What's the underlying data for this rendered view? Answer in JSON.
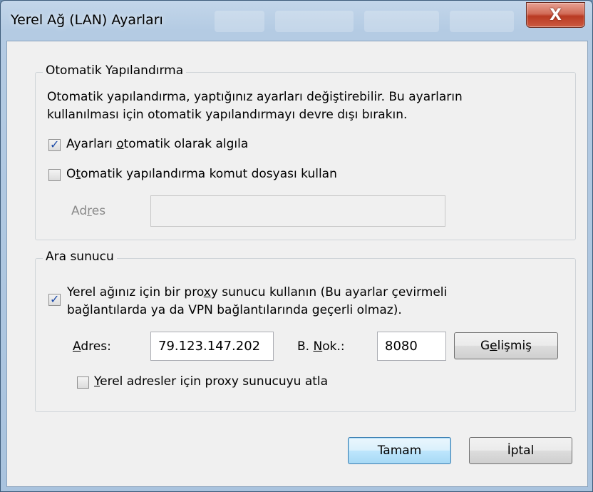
{
  "window": {
    "title": "Yerel Ağ (LAN) Ayarları",
    "close_label": "X"
  },
  "auto_config": {
    "group_title": "Otomatik Yapılandırma",
    "description_line1": "Otomatik yapılandırma, yaptığınız ayarları değiştirebilir. Bu ayarların",
    "description_line2": "kullanılması için otomatik yapılandırmayı devre dışı bırakın.",
    "detect": {
      "label_pre": "Ayarları ",
      "label_u": "o",
      "label_post": "tomatik olarak algıla",
      "checked": true
    },
    "script": {
      "label_pre": "O",
      "label_u": "t",
      "label_post": "omatik yapılandırma komut dosyası kullan",
      "checked": false
    },
    "address": {
      "label_pre": "Ad",
      "label_u": "r",
      "label_post": "es",
      "value": ""
    }
  },
  "proxy": {
    "group_title": "Ara sunucu",
    "use_proxy": {
      "line1_pre": "Yerel ağınız için bir pro",
      "line1_u": "x",
      "line1_post": "y sunucu kullanın (Bu ayarlar çevirmeli",
      "line2": "bağlantılarda ya da VPN bağlantılarında geçerli olmaz).",
      "checked": true
    },
    "address": {
      "label_u": "A",
      "label_post": "dres:",
      "value": "79.123.147.202"
    },
    "port": {
      "label_pre": "B. ",
      "label_u": "N",
      "label_post": "ok.:",
      "value": "8080"
    },
    "advanced": {
      "label_pre": "G",
      "label_u": "e",
      "label_post": "lişmiş"
    },
    "bypass": {
      "label_pre": "",
      "label_u": "Y",
      "label_post": "erel adresler için proxy sunucuyu atla",
      "checked": false
    }
  },
  "buttons": {
    "ok": "Tamam",
    "cancel": "İptal"
  }
}
